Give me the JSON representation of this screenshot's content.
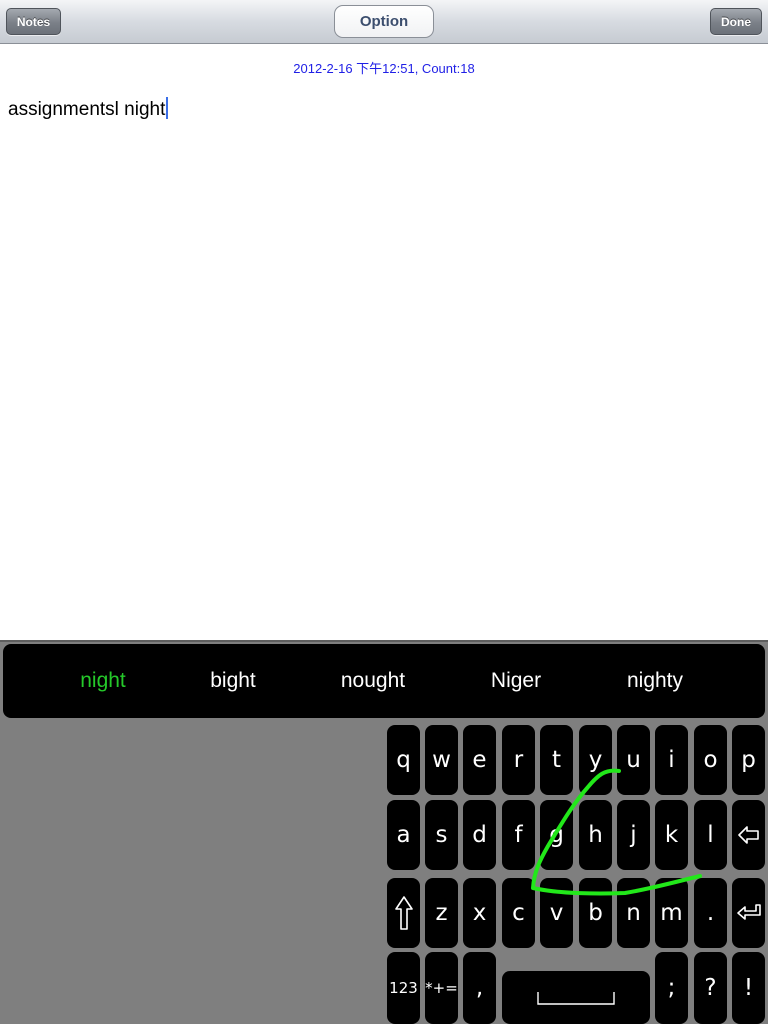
{
  "toolbar": {
    "notes_label": "Notes",
    "option_label": "Option",
    "done_label": "Done"
  },
  "note": {
    "meta": "2012-2-16 下午12:51, Count:18",
    "text": "assignmentsl night"
  },
  "candidates": [
    "night",
    "bight",
    "nought",
    "Niger",
    "nighty"
  ],
  "keyboard": {
    "row1": [
      "q",
      "w",
      "e",
      "r",
      "t",
      "y",
      "u",
      "i",
      "o",
      "p"
    ],
    "row2": [
      "a",
      "s",
      "d",
      "f",
      "g",
      "h",
      "j",
      "k",
      "l"
    ],
    "row3": [
      "z",
      "x",
      "c",
      "v",
      "b",
      "n",
      "m",
      "."
    ],
    "numbers_label": "123",
    "symbols_label": "*+=",
    "comma_label": ",",
    "semicolon_label": ";",
    "question_label": "?",
    "exclaim_label": "!"
  },
  "colors": {
    "active_candidate": "#25c92a",
    "swipe_trace": "#22e81a",
    "meta_text": "#1f1fe6",
    "caret": "#3a6ee8"
  }
}
